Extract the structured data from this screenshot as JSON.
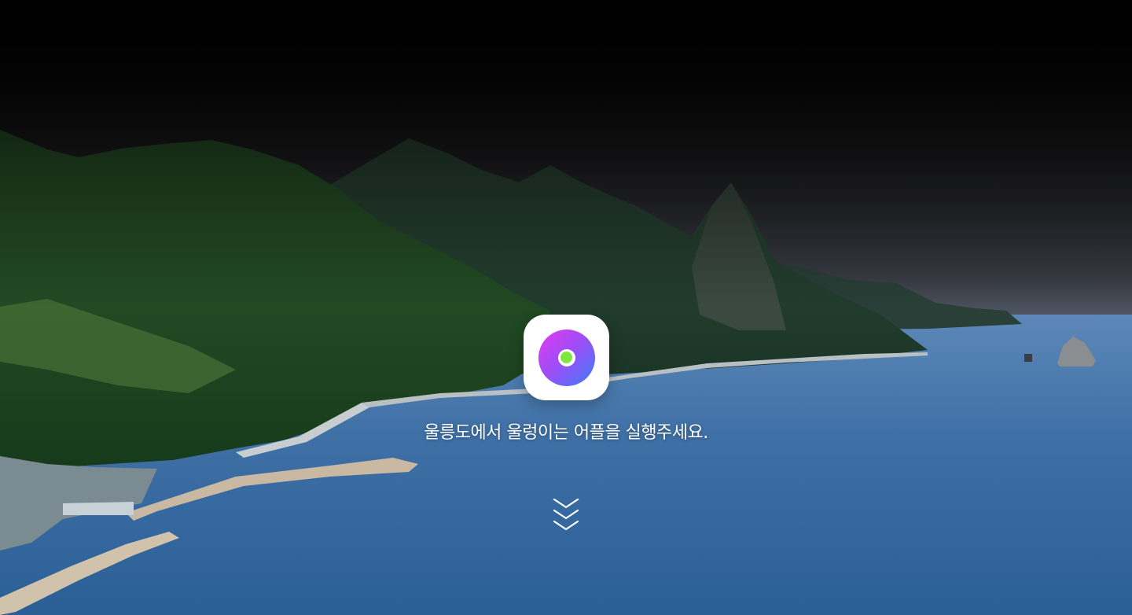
{
  "hero": {
    "background": "ulleungdo-coastline-photo",
    "app_icon": {
      "icon": "disc-app-icon",
      "colors": {
        "tile": "#ffffff",
        "gradient_start": "#e23cf0",
        "gradient_end": "#3c7df5",
        "center_dot": "#7ee83c"
      }
    },
    "message": "울릉도에서 울렁이는 어플을 실행주세요.",
    "scroll_indicator": {
      "icon": "triple-chevron-down-icon",
      "color": "#ffffff"
    }
  }
}
